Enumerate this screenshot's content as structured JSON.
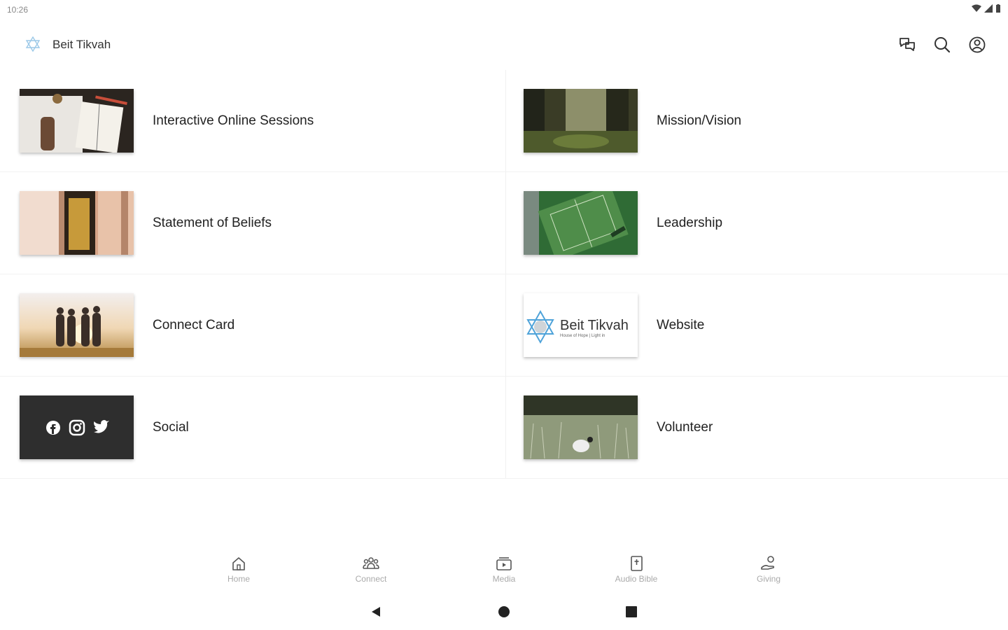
{
  "status_bar": {
    "time": "10:26"
  },
  "app_bar": {
    "title": "Beit Tikvah"
  },
  "grid": {
    "items": [
      {
        "label": "Interactive Online Sessions"
      },
      {
        "label": "Mission/Vision"
      },
      {
        "label": "Statement of Beliefs"
      },
      {
        "label": "Leadership"
      },
      {
        "label": "Connect Card"
      },
      {
        "label": "Website"
      },
      {
        "label": "Social"
      },
      {
        "label": "Volunteer"
      }
    ],
    "website_thumb_logo": "Beit Tikvah",
    "website_thumb_subtitle": "House of Hope | Light in"
  },
  "bottom_nav": {
    "items": [
      {
        "label": "Home",
        "icon": "home-icon"
      },
      {
        "label": "Connect",
        "icon": "group-icon"
      },
      {
        "label": "Media",
        "icon": "media-icon"
      },
      {
        "label": "Audio Bible",
        "icon": "bible-icon"
      },
      {
        "label": "Giving",
        "icon": "giving-icon"
      }
    ]
  },
  "colors": {
    "accent": "#4fa3d9",
    "text": "#222222",
    "nav_label": "#aaaaaa"
  }
}
